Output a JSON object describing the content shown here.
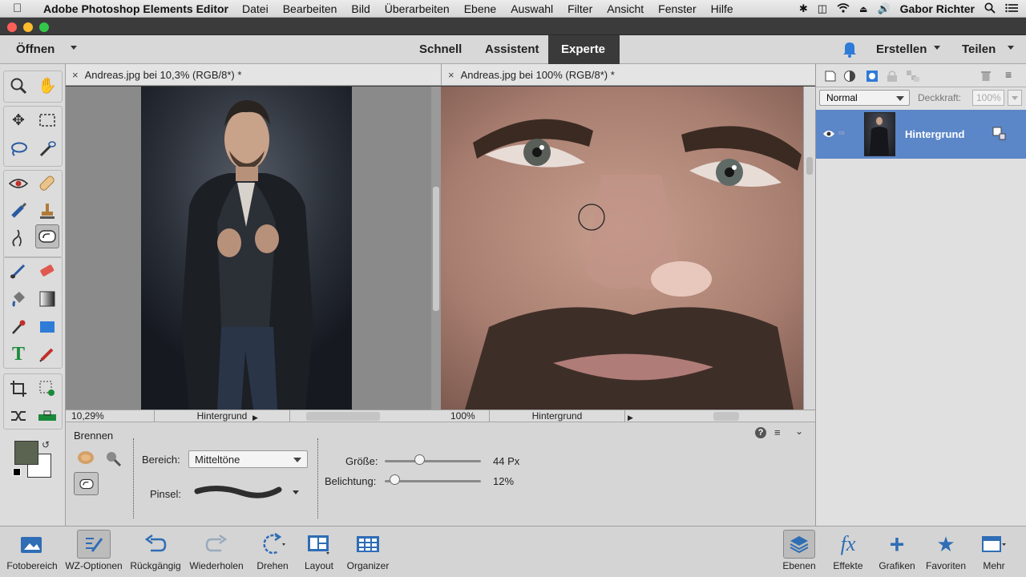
{
  "menubar": {
    "app_name": "Adobe Photoshop Elements Editor",
    "items": [
      "Datei",
      "Bearbeiten",
      "Bild",
      "Überarbeiten",
      "Ebene",
      "Auswahl",
      "Filter",
      "Ansicht",
      "Fenster",
      "Hilfe"
    ],
    "user": "Gabor Richter"
  },
  "modebar": {
    "open_label": "Öffnen",
    "tabs": [
      "Schnell",
      "Assistent",
      "Experte"
    ],
    "create_label": "Erstellen",
    "share_label": "Teilen"
  },
  "doc_left": {
    "title": "Andreas.jpg bei 10,3% (RGB/8*) *",
    "zoom": "10,29%",
    "layer": "Hintergrund"
  },
  "doc_right": {
    "title": "Andreas.jpg bei 100% (RGB/8*) *",
    "zoom": "100%",
    "layer": "Hintergrund"
  },
  "options": {
    "tool_name": "Brennen",
    "range_label": "Bereich:",
    "range_value": "Mitteltöne",
    "brush_label": "Pinsel:",
    "size_label": "Größe:",
    "size_value": "44 Px",
    "size_fraction": 0.36,
    "exposure_label": "Belichtung:",
    "exposure_value": "12%",
    "exposure_fraction": 0.1
  },
  "layers": {
    "blend_mode": "Normal",
    "opacity_label": "Deckkraft:",
    "opacity_value": "100%",
    "layer_name": "Hintergrund"
  },
  "bottombar": {
    "fotobereich": "Fotobereich",
    "wz_optionen": "WZ-Optionen",
    "rueckgaengig": "Rückgängig",
    "wiederholen": "Wiederholen",
    "drehen": "Drehen",
    "layout": "Layout",
    "organizer": "Organizer",
    "ebenen": "Ebenen",
    "effekte": "Effekte",
    "grafiken": "Grafiken",
    "favoriten": "Favoriten",
    "mehr": "Mehr"
  }
}
